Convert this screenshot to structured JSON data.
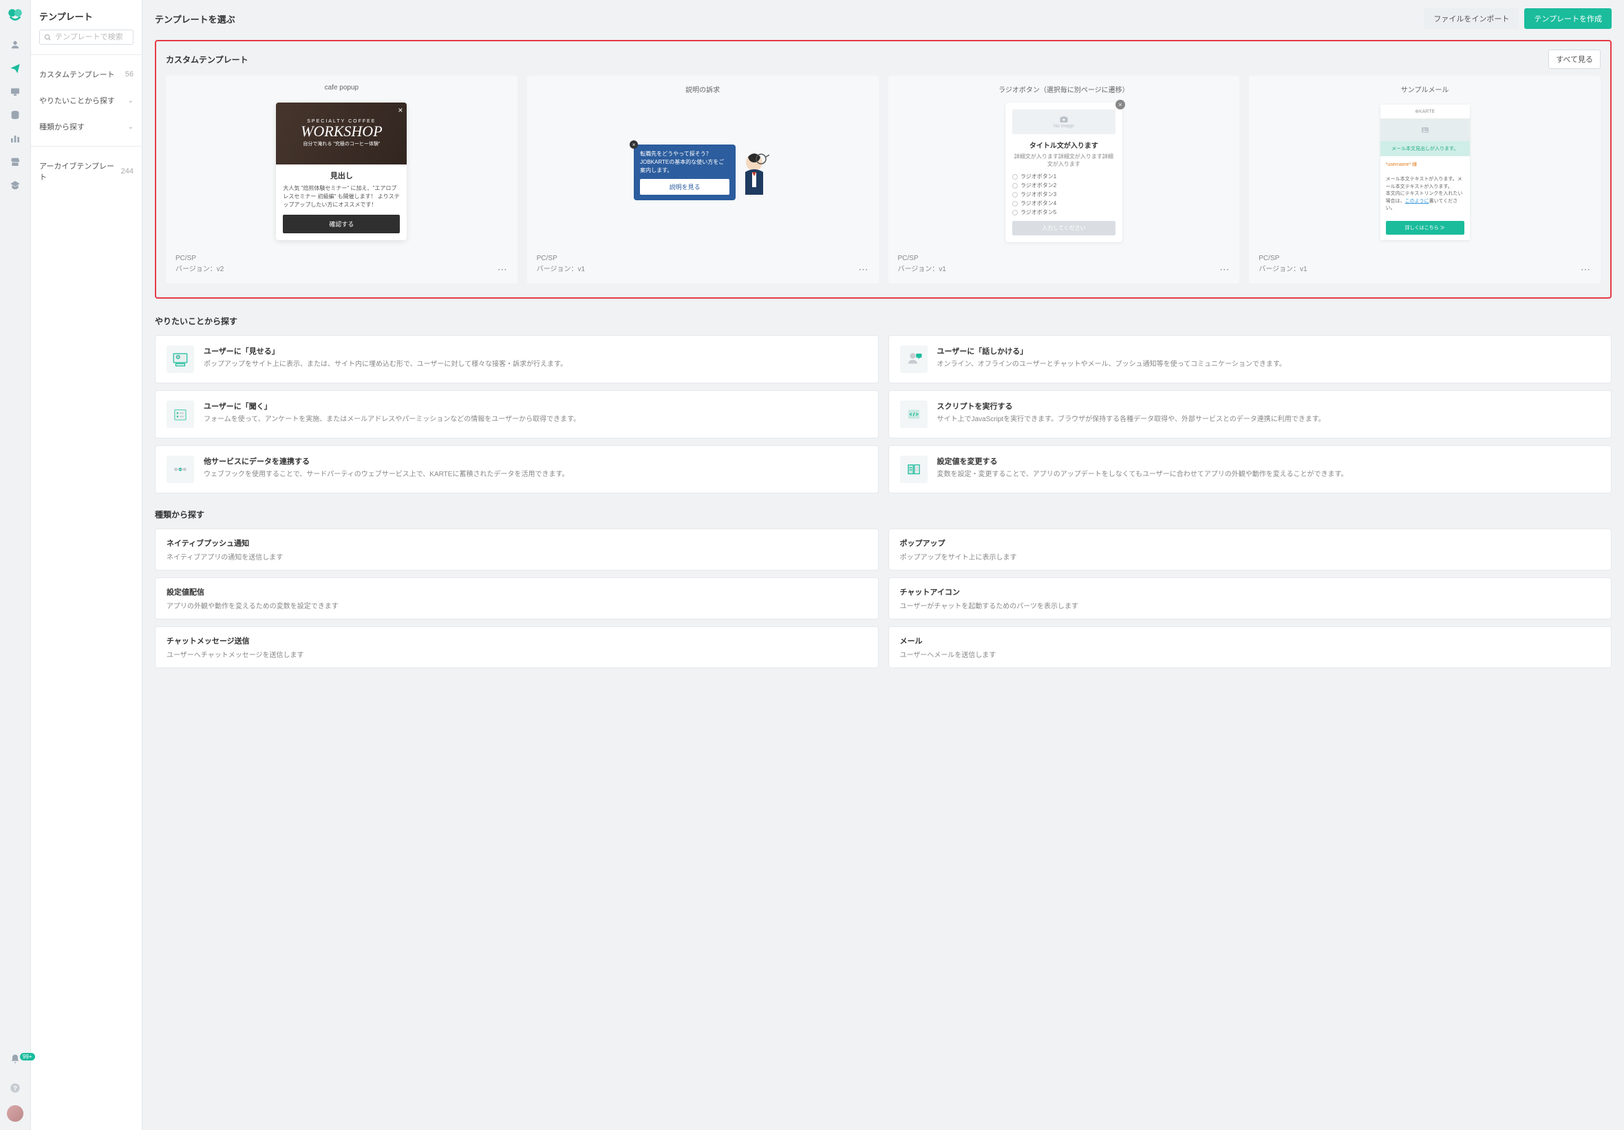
{
  "rail": {
    "notif_badge": "99+"
  },
  "sidebar": {
    "title": "テンプレート",
    "search_placeholder": "テンプレートで検索",
    "items": [
      {
        "label": "カスタムテンプレート",
        "meta": "56"
      },
      {
        "label": "やりたいことから探す",
        "meta": "chev"
      },
      {
        "label": "種類から探す",
        "meta": "chev"
      },
      {
        "label": "アーカイブテンプレート",
        "meta": "244"
      }
    ]
  },
  "topbar": {
    "title": "テンプレートを選ぶ",
    "import_btn": "ファイルをインポート",
    "create_btn": "テンプレートを作成"
  },
  "custom": {
    "heading": "カスタムテンプレート",
    "see_all": "すべて見る",
    "cards": [
      {
        "title": "cafe popup",
        "platform": "PC/SP",
        "version": "バージョン：v2",
        "preview": {
          "img_top": "SPECIALTY COFFEE",
          "img_title": "WORKSHOP",
          "img_sub": "自分で淹れる \"究極のコーヒー体験\"",
          "heading": "見出し",
          "body": "大人気 \"焙煎体験セミナー\" に加え、\"エアロプレスセミナー 初級編\" も開催します！\nよりステップアップしたい方にオススメです！",
          "button": "確認する"
        }
      },
      {
        "title": "説明の訴求",
        "platform": "PC/SP",
        "version": "バージョン：v1",
        "preview": {
          "line1": "転職先をどうやって探そう？",
          "line2": "JOBKARTEの基本的な使い方をご案内します。",
          "button": "説明を見る"
        }
      },
      {
        "title": "ラジオボタン（選択毎に別ページに遷移）",
        "platform": "PC/SP",
        "version": "バージョン：v1",
        "preview": {
          "noimg": "No image",
          "heading": "タイトル文が入ります",
          "desc": "詳細文が入ります詳細文が入ります詳細文が入ります",
          "radios": [
            "ラジオボタン1",
            "ラジオボタン2",
            "ラジオボタン3",
            "ラジオボタン4",
            "ラジオボタン5"
          ],
          "button": "入力してください"
        }
      },
      {
        "title": "サンプルメール",
        "platform": "PC/SP",
        "version": "バージョン：v1",
        "preview": {
          "brand": "⊕KARTE",
          "hero_title": "メール本文見出しが入ります。",
          "username": "*username* 様",
          "body1": "メール本文テキストが入ります。メール本文テキストが入ります。",
          "body2": "本文内にテキストリンクを入れたい場合は、",
          "link": "このように",
          "body3": "書いてください。",
          "button": "詳しくはこちら ≫"
        }
      }
    ]
  },
  "goals": {
    "heading": "やりたいことから探す",
    "items": [
      {
        "title": "ユーザーに「見せる」",
        "desc": "ポップアップをサイト上に表示、または、サイト内に埋め込む形で、ユーザーに対して様々な接客・訴求が行えます。"
      },
      {
        "title": "ユーザーに「話しかける」",
        "desc": "オンライン、オフラインのユーザーとチャットやメール、プッシュ通知等を使ってコミュニケーションできます。"
      },
      {
        "title": "ユーザーに「聞く」",
        "desc": "フォームを使って、アンケートを実施、またはメールアドレスやパーミッションなどの情報をユーザーから取得できます。"
      },
      {
        "title": "スクリプトを実行する",
        "desc": "サイト上でJavaScriptを実行できます。ブラウザが保持する各種データ取得や、外部サービスとのデータ連携に利用できます。"
      },
      {
        "title": "他サービスにデータを連携する",
        "desc": "ウェブフックを使用することで、サードパーティのウェブサービス上で、KARTEに蓄積されたデータを活用できます。"
      },
      {
        "title": "設定値を変更する",
        "desc": "変数を設定・変更することで、アプリのアップデートをしなくてもユーザーに合わせてアプリの外観や動作を変えることができます。"
      }
    ]
  },
  "types": {
    "heading": "種類から探す",
    "items": [
      {
        "title": "ネイティブプッシュ通知",
        "desc": "ネイティブアプリの通知を送信します"
      },
      {
        "title": "ポップアップ",
        "desc": "ポップアップをサイト上に表示します"
      },
      {
        "title": "設定値配信",
        "desc": "アプリの外観や動作を変えるための変数を設定できます"
      },
      {
        "title": "チャットアイコン",
        "desc": "ユーザーがチャットを起動するためのパーツを表示します"
      },
      {
        "title": "チャットメッセージ送信",
        "desc": "ユーザーへチャットメッセージを送信します"
      },
      {
        "title": "メール",
        "desc": "ユーザーへメールを送信します"
      }
    ]
  }
}
